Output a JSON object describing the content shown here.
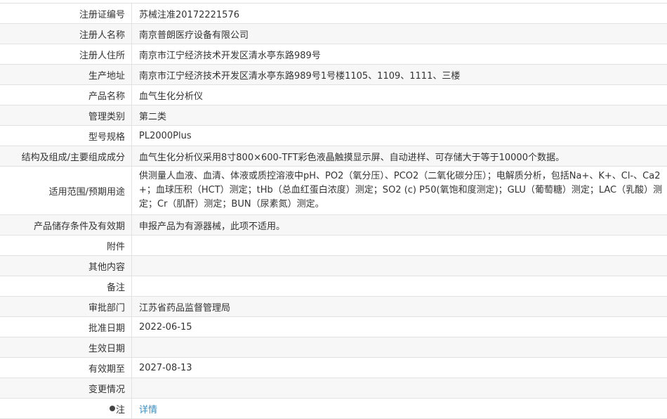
{
  "rows": [
    {
      "label": "注册证编号",
      "value": "苏械注准20172221576"
    },
    {
      "label": "注册人名称",
      "value": "南京普朗医疗设备有限公司"
    },
    {
      "label": "注册人住所",
      "value": "南京市江宁经济技术开发区清水亭东路989号"
    },
    {
      "label": "生产地址",
      "value": "南京市江宁经济技术开发区清水亭东路989号1号楼1105、1109、1111、三楼"
    },
    {
      "label": "产品名称",
      "value": "血气生化分析仪"
    },
    {
      "label": "管理类别",
      "value": "第二类"
    },
    {
      "label": "型号规格",
      "value": "PL2000Plus"
    },
    {
      "label": "结构及组成/主要组成成分",
      "value": "血气生化分析仪采用8寸800×600-TFT彩色液晶触摸显示屏、自动进样、可存储大于等于10000个数据。"
    },
    {
      "label": "适用范围/预期用途",
      "value": "供测量人血液、血清、体液或质控溶液中pH、PO2（氧分压）、PCO2（二氧化碳分压）；电解质分析，包括Na+、K+、Cl-、Ca2+；血球压积（HCT）测定；tHb（总血红蛋白浓度）测定；SO2 (c) P50(氧饱和度测定)；GLU（葡萄糖）测定；LAC（乳酸）测定；Cr（肌酐）测定；BUN（尿素氮）测定。"
    },
    {
      "label": "产品储存条件及有效期",
      "value": "申报产品为有源器械，此项不适用。"
    },
    {
      "label": "附件",
      "value": ""
    },
    {
      "label": "其他内容",
      "value": ""
    },
    {
      "label": "备注",
      "value": ""
    },
    {
      "label": "审批部门",
      "value": "江苏省药品监督管理局"
    },
    {
      "label": "批准日期",
      "value": "2022-06-15"
    },
    {
      "label": "生效日期",
      "value": ""
    },
    {
      "label": "有效期至",
      "value": "2027-08-13"
    },
    {
      "label": "变更情况",
      "value": ""
    }
  ],
  "note": {
    "label": "注",
    "link": "详情",
    "icon": "bulb-icon"
  }
}
